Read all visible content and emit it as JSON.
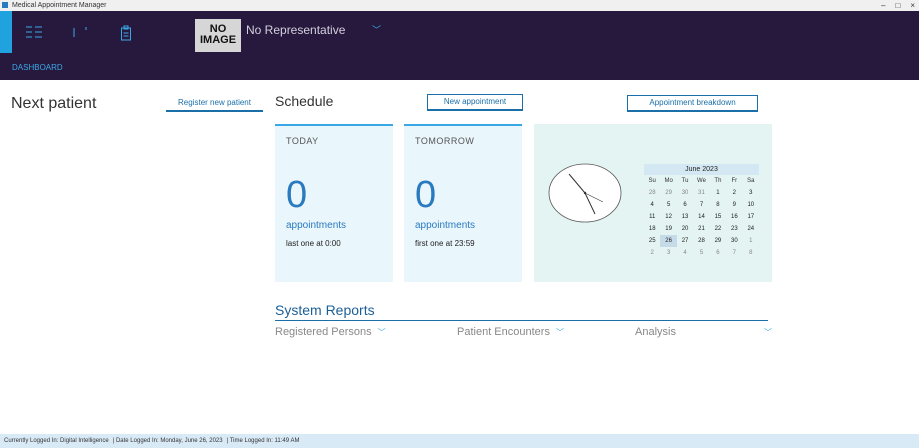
{
  "titlebar": {
    "title": "Medical Appointment Manager",
    "controls": [
      "–",
      "□",
      "×"
    ]
  },
  "header": {
    "no_image": "NO IMAGE",
    "representative": "No Representative",
    "nav_link": "DASHBOARD",
    "icons": [
      "grid-icon",
      "divider-icon",
      "clipboard-icon"
    ]
  },
  "next_patient": {
    "title": "Next patient",
    "register_button": "Register new patient"
  },
  "schedule": {
    "title": "Schedule",
    "new_appointment_button": "New appointment",
    "breakdown_button": "Appointment breakdown",
    "today": {
      "label": "TODAY",
      "count": "0",
      "unit": "appointments",
      "note": "last one at 0:00"
    },
    "tomorrow": {
      "label": "TOMORROW",
      "count": "0",
      "unit": "appointments",
      "note": "first one at 23:59"
    }
  },
  "calendar": {
    "month": "June 2023",
    "days_of_week": [
      "Su",
      "Mo",
      "Tu",
      "We",
      "Th",
      "Fr",
      "Sa"
    ],
    "weeks": [
      [
        "28",
        "29",
        "30",
        "31",
        "1",
        "2",
        "3"
      ],
      [
        "4",
        "5",
        "6",
        "7",
        "8",
        "9",
        "10"
      ],
      [
        "11",
        "12",
        "13",
        "14",
        "15",
        "16",
        "17"
      ],
      [
        "18",
        "19",
        "20",
        "21",
        "22",
        "23",
        "24"
      ],
      [
        "25",
        "26",
        "27",
        "28",
        "29",
        "30",
        "1"
      ],
      [
        "2",
        "3",
        "4",
        "5",
        "6",
        "7",
        "8"
      ]
    ],
    "selected": "26"
  },
  "system_reports": {
    "title": "System Reports",
    "items": [
      {
        "label": "Registered Persons"
      },
      {
        "label": "Patient Encounters"
      },
      {
        "label": "Analysis"
      }
    ]
  },
  "statusbar": {
    "logged_in": "Currently Logged In: Digital Intelligence",
    "date": "Date Logged In: Monday, June 26, 2023",
    "time": "Time Logged In: 11:49 AM"
  },
  "colors": {
    "header": "#27193e",
    "accent": "#39a9e6",
    "link": "#1b6fa8",
    "card": "#e9f6fc"
  }
}
